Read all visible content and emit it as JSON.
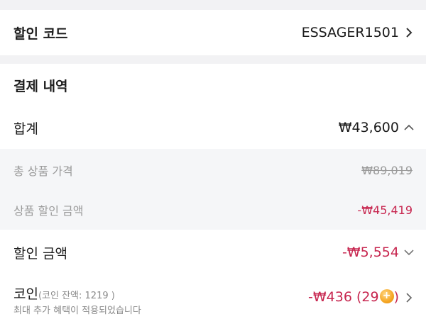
{
  "discount_code": {
    "label": "할인 코드",
    "value": "ESSAGER1501"
  },
  "payment": {
    "section_title": "결제 내역",
    "total": {
      "label": "합계",
      "value": "₩43,600"
    },
    "original_price": {
      "label": "총 상품 가격",
      "value": "₩89,019"
    },
    "product_discount": {
      "label": "상품 할인 금액",
      "value": "-₩45,419"
    },
    "discount_amount": {
      "label": "할인 금액",
      "value": "-₩5,554"
    },
    "coin": {
      "label": "코인",
      "balance_note": "(코인 잔액: 1219 )",
      "sub_note": "최대 추가 혜택이 적용되었습니다",
      "value": "-₩436 (29",
      "value_close": ")"
    }
  },
  "colors": {
    "discount_red": "#c7264f",
    "muted_gray": "#9a9a9a",
    "subsection_bg": "#f5f6f8",
    "page_bg": "#f2f2f4"
  },
  "icons": {
    "code_chevron": "chevron-right-icon",
    "total_chevron": "chevron-up-icon",
    "discount_chevron": "chevron-down-icon",
    "coin_chevron": "chevron-right-icon",
    "coin_badge": "coin-icon"
  }
}
